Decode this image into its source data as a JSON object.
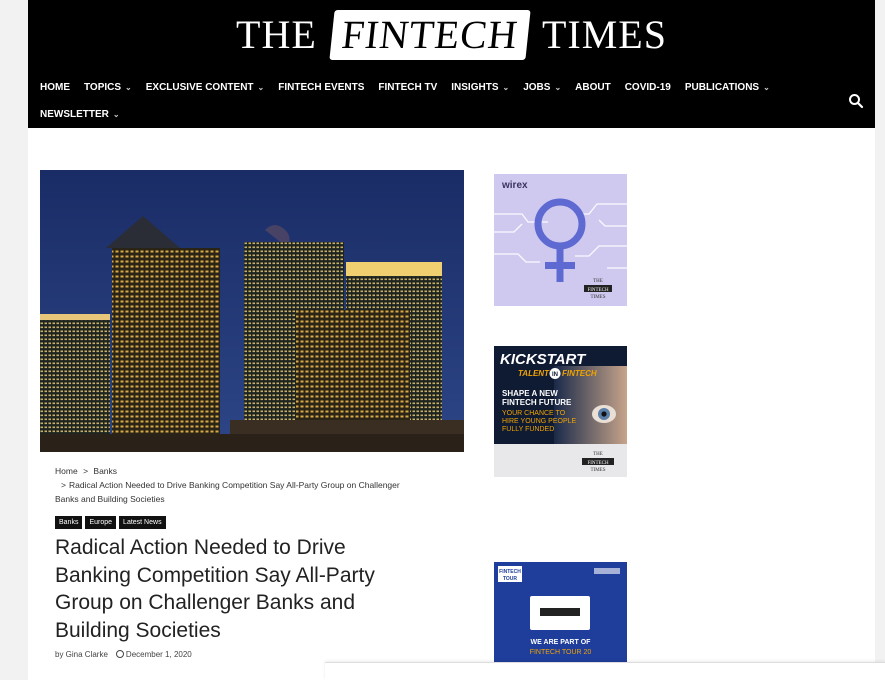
{
  "header": {
    "logo_left": "THE",
    "logo_mid": "FINTECH",
    "logo_right": "TIMES",
    "nav": [
      {
        "label": "HOME",
        "dropdown": false
      },
      {
        "label": "TOPICS",
        "dropdown": true
      },
      {
        "label": "EXCLUSIVE CONTENT",
        "dropdown": true
      },
      {
        "label": "FINTECH EVENTS",
        "dropdown": false
      },
      {
        "label": "FINTECH TV",
        "dropdown": false
      },
      {
        "label": "INSIGHTS",
        "dropdown": true
      },
      {
        "label": "JOBS",
        "dropdown": true
      },
      {
        "label": "ABOUT",
        "dropdown": false
      },
      {
        "label": "COVID-19",
        "dropdown": false
      },
      {
        "label": "PUBLICATIONS",
        "dropdown": true
      },
      {
        "label": "NEWSLETTER",
        "dropdown": true
      }
    ],
    "search_icon": "search-icon"
  },
  "article": {
    "breadcrumb": {
      "home": "Home",
      "sep": ">",
      "section": "Banks",
      "current": "Radical Action Needed to Drive Banking Competition Say All-Party Group on Challenger Banks and Building Societies"
    },
    "tags": [
      "Banks",
      "Europe",
      "Latest News"
    ],
    "title": "Radical Action Needed to Drive Banking Competition Say All-Party Group on Challenger Banks and Building Societies",
    "author": "by Gina Clarke",
    "date": "December 1, 2020"
  },
  "sidebar": {
    "ad1": {
      "brand": "wirex",
      "footer_top": "THE",
      "footer_mid": "FINTECH",
      "footer_bot": "TIMES"
    },
    "ad2": {
      "line1": "KICKSTART",
      "line2a": "TALENT",
      "line2b": "IN",
      "line2c": "FINTECH",
      "headline1": "SHAPE A NEW",
      "headline2": "FINTECH FUTURE",
      "sub1": "YOUR CHANCE TO",
      "sub2": "HIRE YOUNG PEOPLE",
      "sub3": "FULLY FUNDED",
      "footer_top": "THE",
      "footer_mid": "FINTECH",
      "footer_bot": "TIMES"
    },
    "ad3": {
      "badge1": "FINTECH",
      "badge2": "TOUR",
      "cta1": "WE ARE PART OF",
      "cta2": "FINTECH TOUR 20"
    }
  },
  "colors": {
    "header_bg": "#000000",
    "accent_purple": "#5e6ad2",
    "ad3_bg": "#1f3d9a",
    "ad2_bg": "#0f1a33"
  }
}
